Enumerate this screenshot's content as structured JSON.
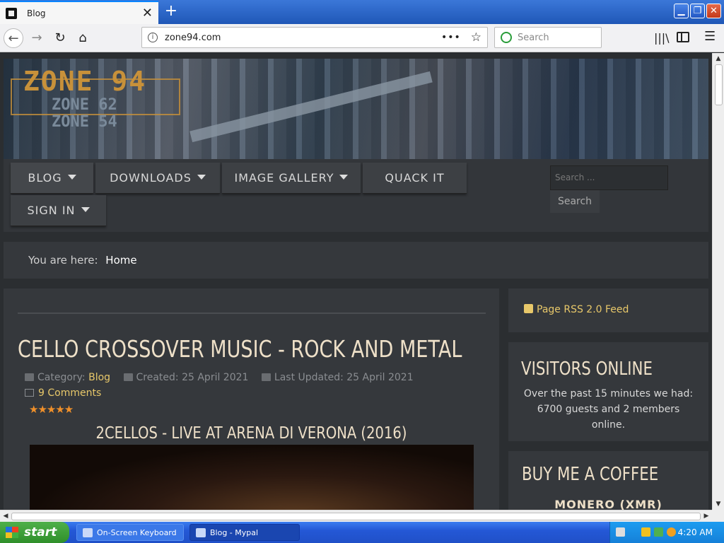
{
  "browser": {
    "tab_title": "Blog",
    "new_tab": "+",
    "url": "zone94.com",
    "search_placeholder": "Search",
    "page_actions": "•••"
  },
  "site": {
    "logo_main": "ZONE 94",
    "logo_sub": [
      "ZONE 62",
      "ZONE 54"
    ],
    "menu": [
      {
        "label": "BLOG",
        "has_dropdown": true,
        "active": true
      },
      {
        "label": "DOWNLOADS",
        "has_dropdown": true
      },
      {
        "label": "IMAGE GALLERY",
        "has_dropdown": true
      },
      {
        "label": "QUACK IT",
        "has_dropdown": false
      },
      {
        "label": "SIGN IN",
        "has_dropdown": true
      }
    ],
    "search_placeholder": "Search ...",
    "search_button": "Search",
    "accent": "#e8c86a",
    "rating_color": "#f0902a"
  },
  "breadcrumb": {
    "prefix": "You are here:",
    "current": "Home"
  },
  "article": {
    "title": "CELLO CROSSOVER MUSIC - ROCK AND METAL",
    "category_label": "Category:",
    "category": "Blog",
    "created": "Created: 25 April 2021",
    "updated": "Last Updated: 25 April 2021",
    "comments": "9 Comments",
    "stars": "★★★★★",
    "rating": 5,
    "video_title": "2CELLOS - LIVE AT ARENA DI VERONA (2016)"
  },
  "sidebar": {
    "rss": "Page RSS 2.0 Feed",
    "visitors_title": "VISITORS ONLINE",
    "visitors_text": "Over the past 15 minutes we had: 6700 guests and 2 members online.",
    "coffee_title": "BUY ME A COFFEE",
    "coffee_item": "MONERO (XMR)"
  },
  "taskbar": {
    "start": "start",
    "tasks": [
      "On-Screen Keyboard",
      "Blog - Mypal"
    ],
    "clock": "4:20 AM"
  }
}
